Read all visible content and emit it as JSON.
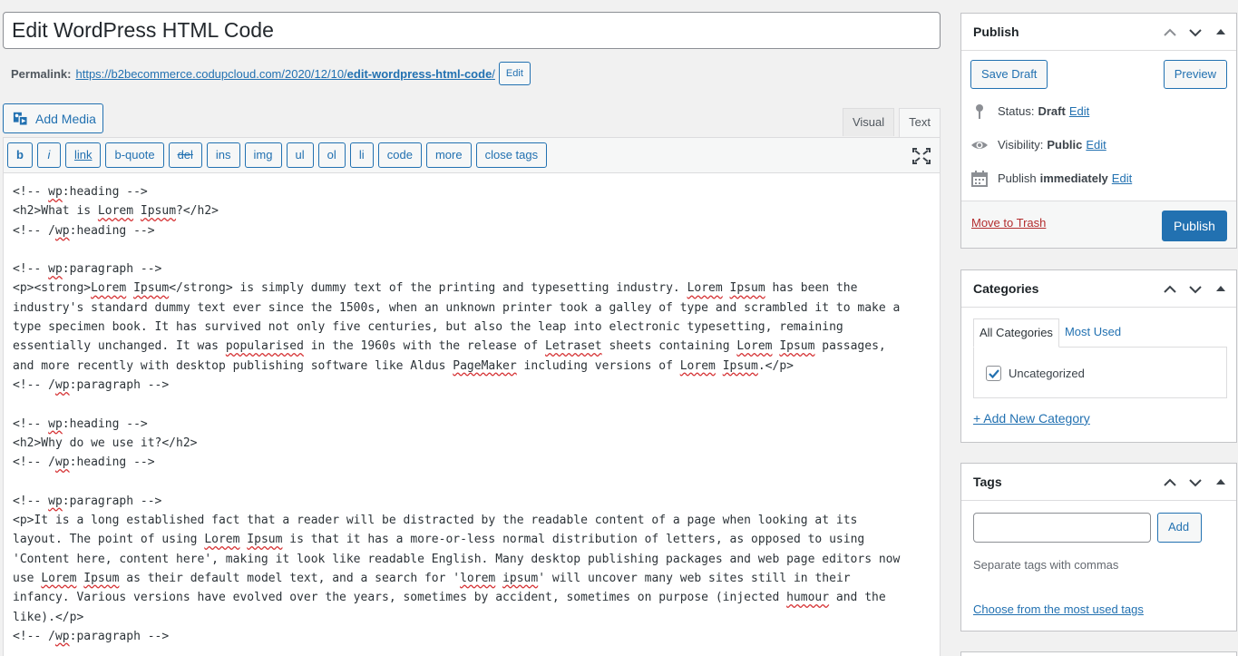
{
  "post": {
    "title": "Edit WordPress HTML Code",
    "permalink_label": "Permalink:",
    "permalink_base": "https://b2becommerce.codupcloud.com/2020/12/10/",
    "permalink_slug": "edit-wordpress-html-code",
    "permalink_trail": "/",
    "permalink_edit": "Edit"
  },
  "toolbar": {
    "add_media": "Add Media",
    "tabs": [
      "Visual",
      "Text"
    ],
    "quicktags": [
      "b",
      "i",
      "link",
      "b-quote",
      "del",
      "ins",
      "img",
      "ul",
      "ol",
      "li",
      "code",
      "more",
      "close tags"
    ]
  },
  "editor": {
    "content_lines": [
      "<!-- wp:heading -->",
      "<h2>What is Lorem Ipsum?</h2>",
      "<!-- /wp:heading -->",
      "",
      "<!-- wp:paragraph -->",
      "<p><strong>Lorem Ipsum</strong> is simply dummy text of the printing and typesetting industry. Lorem Ipsum has been the",
      "industry's standard dummy text ever since the 1500s, when an unknown printer took a galley of type and scrambled it to make a",
      "type specimen book. It has survived not only five centuries, but also the leap into electronic typesetting, remaining",
      "essentially unchanged. It was popularised in the 1960s with the release of Letraset sheets containing Lorem Ipsum passages,",
      "and more recently with desktop publishing software like Aldus PageMaker including versions of Lorem Ipsum.</p>",
      "<!-- /wp:paragraph -->",
      "",
      "<!-- wp:heading -->",
      "<h2>Why do we use it?</h2>",
      "<!-- /wp:heading -->",
      "",
      "<!-- wp:paragraph -->",
      "<p>It is a long established fact that a reader will be distracted by the readable content of a page when looking at its",
      "layout. The point of using Lorem Ipsum is that it has a more-or-less normal distribution of letters, as opposed to using",
      "'Content here, content here', making it look like readable English. Many desktop publishing packages and web page editors now",
      "use Lorem Ipsum as their default model text, and a search for 'lorem ipsum' will uncover many web sites still in their",
      "infancy. Various versions have evolved over the years, sometimes by accident, sometimes on purpose (injected humour and the",
      "like).</p>",
      "<!-- /wp:paragraph -->"
    ],
    "misspelled": [
      "wp",
      "Lorem",
      "Ipsum",
      "popularised",
      "Letraset",
      "PageMaker",
      "humour",
      "lorem",
      "ipsum"
    ]
  },
  "publish": {
    "title": "Publish",
    "save_draft": "Save Draft",
    "preview": "Preview",
    "status_label": "Status:",
    "status_value": "Draft",
    "visibility_label": "Visibility:",
    "visibility_value": "Public",
    "schedule_label": "Publish",
    "schedule_value": "immediately",
    "edit": "Edit",
    "trash": "Move to Trash",
    "publish_button": "Publish"
  },
  "categories": {
    "title": "Categories",
    "tab_all": "All Categories",
    "tab_used": "Most Used",
    "items": [
      {
        "label": "Uncategorized",
        "checked": true
      }
    ],
    "add_new": "+ Add New Category"
  },
  "tags": {
    "title": "Tags",
    "input_value": "",
    "add": "Add",
    "help": "Separate tags with commas",
    "choose": "Choose from the most used tags"
  },
  "colors": {
    "accent": "#2271b1",
    "danger": "#b32d2e",
    "background": "#f1f1f1"
  }
}
